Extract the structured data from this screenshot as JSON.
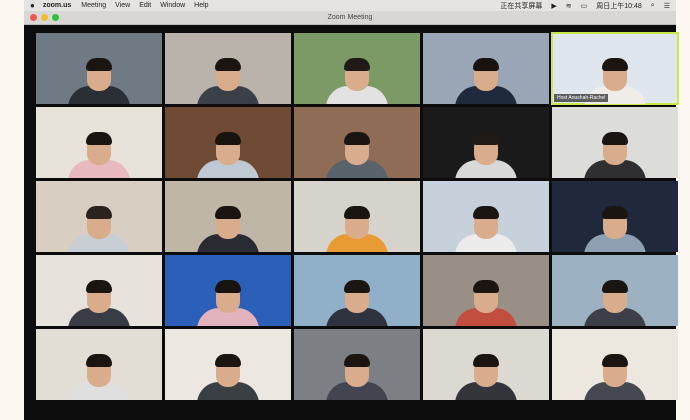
{
  "menubar": {
    "app_name": "zoom.us",
    "items": [
      "Meeting",
      "View",
      "Edit",
      "Window",
      "Help"
    ],
    "status_items": [
      "正在共享屏幕",
      "周日上午10:48"
    ]
  },
  "window": {
    "title": "Zoom Meeting"
  },
  "colors": {
    "active_speaker_border": "#c9e84a"
  },
  "participants": [
    {
      "name": ""
    },
    {
      "name": ""
    },
    {
      "name": ""
    },
    {
      "name": ""
    },
    {
      "name": "Host Anushah-Rachel"
    },
    {
      "name": ""
    },
    {
      "name": ""
    },
    {
      "name": ""
    },
    {
      "name": ""
    },
    {
      "name": ""
    },
    {
      "name": ""
    },
    {
      "name": ""
    },
    {
      "name": ""
    },
    {
      "name": ""
    },
    {
      "name": ""
    },
    {
      "name": ""
    },
    {
      "name": ""
    },
    {
      "name": ""
    },
    {
      "name": ""
    },
    {
      "name": ""
    },
    {
      "name": ""
    },
    {
      "name": ""
    },
    {
      "name": ""
    },
    {
      "name": ""
    },
    {
      "name": ""
    }
  ]
}
